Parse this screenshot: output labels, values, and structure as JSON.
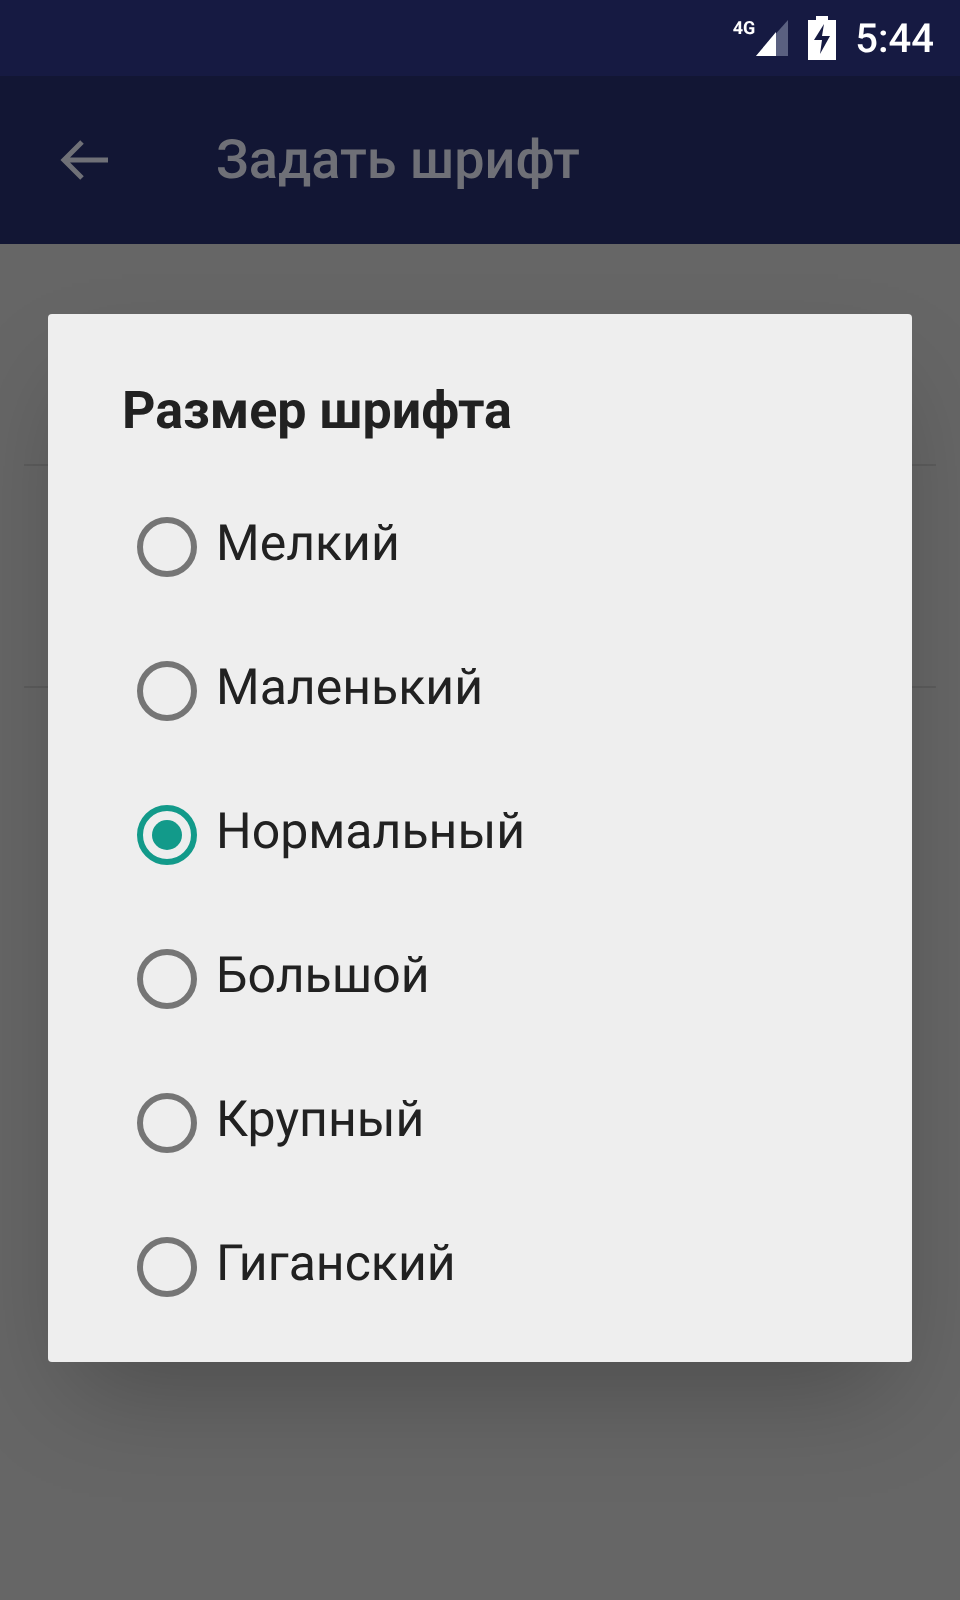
{
  "status_bar": {
    "network": "4G",
    "time": "5:44"
  },
  "app_bar": {
    "title": "Задать шрифт"
  },
  "dialog": {
    "title": "Размер шрифта",
    "options": [
      {
        "label": "Мелкий",
        "selected": false
      },
      {
        "label": "Маленький",
        "selected": false
      },
      {
        "label": "Нормальный",
        "selected": true
      },
      {
        "label": "Большой",
        "selected": false
      },
      {
        "label": "Крупный",
        "selected": false
      },
      {
        "label": "Гиганский",
        "selected": false
      }
    ]
  }
}
